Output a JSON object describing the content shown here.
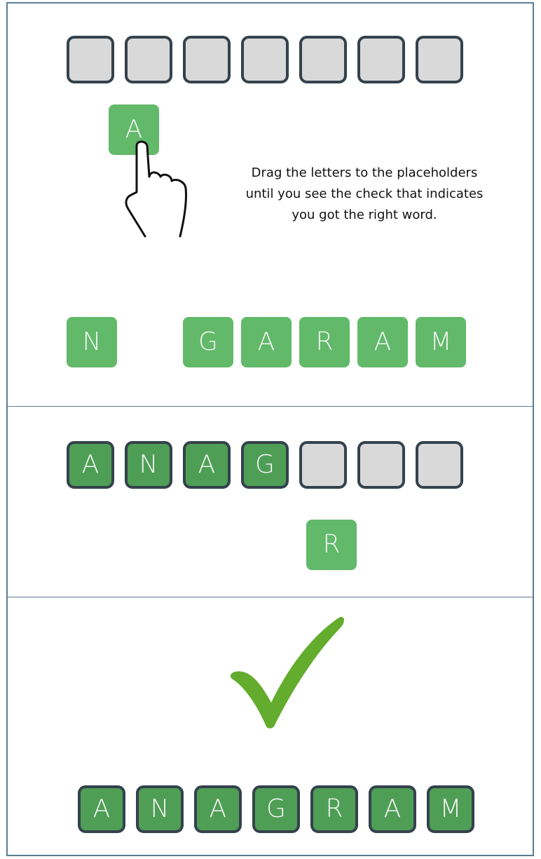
{
  "panel1": {
    "slots": [
      "",
      "",
      "",
      "",
      "",
      "",
      ""
    ],
    "dragged_letter": "A",
    "instructions": "Drag the letters to the placeholders\nuntil you see the check that indicates\nyou got the right word.",
    "pool_letters": [
      "N",
      "G",
      "A",
      "R",
      "A",
      "M"
    ]
  },
  "panel2": {
    "slots": [
      "A",
      "N",
      "A",
      "G",
      "",
      "",
      ""
    ],
    "dragged_letter": "R"
  },
  "panel3": {
    "slots": [
      "A",
      "N",
      "A",
      "G",
      "R",
      "A",
      "M"
    ]
  },
  "icons": {
    "pointer": "hand-pointer-icon",
    "success": "check-mark-icon"
  },
  "colors": {
    "tile_green": "#62b96a",
    "slot_filled_green": "#4f9e56",
    "slot_empty_gray": "#d9d9d9",
    "slot_border": "#34424c",
    "check_green": "#63ac2e",
    "panel_border": "#5a7d94"
  }
}
